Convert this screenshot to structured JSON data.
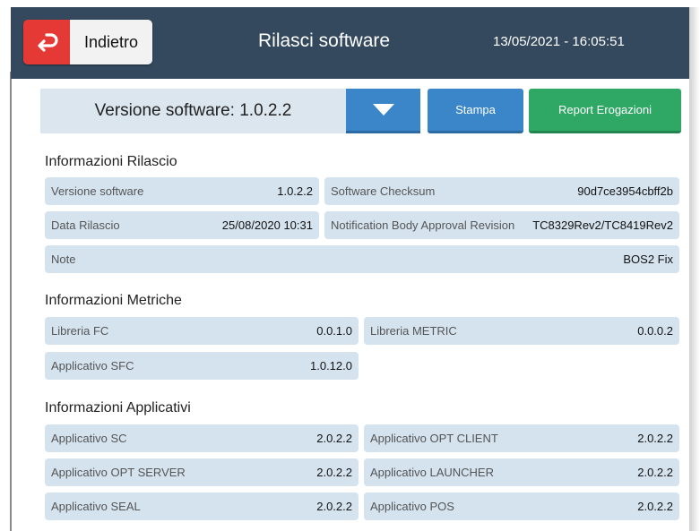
{
  "header": {
    "back_label": "Indietro",
    "title": "Rilasci software",
    "datetime": "13/05/2021 - 16:05:51"
  },
  "toolbar": {
    "version_label": "Versione software: 1.0.2.2",
    "print_label": "Stampa",
    "report_label": "Report Erogazioni"
  },
  "release": {
    "title": "Informazioni Rilascio",
    "version_label": "Versione software",
    "version_value": "1.0.2.2",
    "checksum_label": "Software Checksum",
    "checksum_value": "90d7ce3954cbff2b",
    "date_label": "Data Rilascio",
    "date_value": "25/08/2020 10:31",
    "approval_label": "Notification Body Approval Revision",
    "approval_value": "TC8329Rev2/TC8419Rev2",
    "note_label": "Note",
    "note_value": "BOS2 Fix"
  },
  "metrics": {
    "title": "Informazioni Metriche",
    "fc_label": "Libreria FC",
    "fc_value": "0.0.1.0",
    "metric_label": "Libreria METRIC",
    "metric_value": "0.0.0.2",
    "sfc_label": "Applicativo SFC",
    "sfc_value": "1.0.12.0"
  },
  "apps": {
    "title": "Informazioni Applicativi",
    "sc_label": "Applicativo SC",
    "sc_value": "2.0.2.2",
    "optclient_label": "Applicativo OPT CLIENT",
    "optclient_value": "2.0.2.2",
    "optserver_label": "Applicativo OPT SERVER",
    "optserver_value": "2.0.2.2",
    "launcher_label": "Applicativo LAUNCHER",
    "launcher_value": "2.0.2.2",
    "seal_label": "Applicativo SEAL",
    "seal_value": "2.0.2.2",
    "pos_label": "Applicativo POS",
    "pos_value": "2.0.2.2"
  },
  "colors": {
    "header_bg": "#34495e",
    "back_red": "#e53935",
    "primary_blue": "#3a86c8",
    "report_green": "#2fa866",
    "cell_bg": "#d5e3ef"
  },
  "icons": {
    "back": "return-arrow-icon",
    "dropdown": "chevron-down-icon"
  }
}
